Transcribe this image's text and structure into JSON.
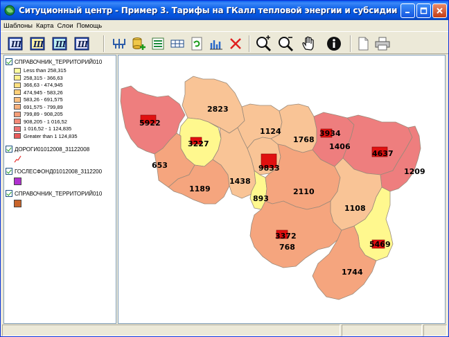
{
  "window": {
    "title": "Ситуционный центр - Пример 3. Тарифы на ГКалл тепловой энергии и субсидии"
  },
  "menu": {
    "items": [
      "Шаблоны",
      "Карта",
      "Слои",
      "Помощь"
    ]
  },
  "legend": {
    "layer1": {
      "name": "СПРАВОЧНИК_ТЕРРИТОРИЙ010",
      "classes": [
        {
          "label": "Less than 258,315",
          "color": "#FFFFA0"
        },
        {
          "label": "258,315 - 366,63",
          "color": "#FFF08C"
        },
        {
          "label": "366,63 - 474,945",
          "color": "#FFE080"
        },
        {
          "label": "474,945 - 583,26",
          "color": "#FFD07A"
        },
        {
          "label": "583,26 - 691,575",
          "color": "#FBC080"
        },
        {
          "label": "691,575 - 799,89",
          "color": "#F7B07C"
        },
        {
          "label": "799,89 - 908,205",
          "color": "#F59E78"
        },
        {
          "label": "908,205 - 1 016,52",
          "color": "#F38A78"
        },
        {
          "label": "1 016,52 - 1 124,835",
          "color": "#EF7474"
        },
        {
          "label": "Greater than 1 124,835",
          "color": "#E85A5A"
        }
      ]
    },
    "layer2": {
      "name": "ДОРОГИ01012008_31122008",
      "color": "#E83030"
    },
    "layer3": {
      "name": "ГОСЛЕСФОНД01012008_3112200",
      "color": "#B030D0"
    },
    "layer4": {
      "name": "СПРАВОЧНИК_ТЕРРИТОРИЙ010",
      "color": "#C8642A"
    }
  },
  "map": {
    "labels": [
      "5922",
      "2823",
      "3227",
      "653",
      "1189",
      "1124",
      "1768",
      "3934",
      "1406",
      "4637",
      "1209",
      "9833",
      "1438",
      "893",
      "2110",
      "1108",
      "3372",
      "768",
      "5469",
      "1744"
    ],
    "colors": {
      "deep": "#EE7E7E",
      "salmon": "#F5A57E",
      "light": "#F9C496",
      "yellow": "#FFF88E",
      "border": "#9A8A7A",
      "marker": "#E01010"
    }
  }
}
